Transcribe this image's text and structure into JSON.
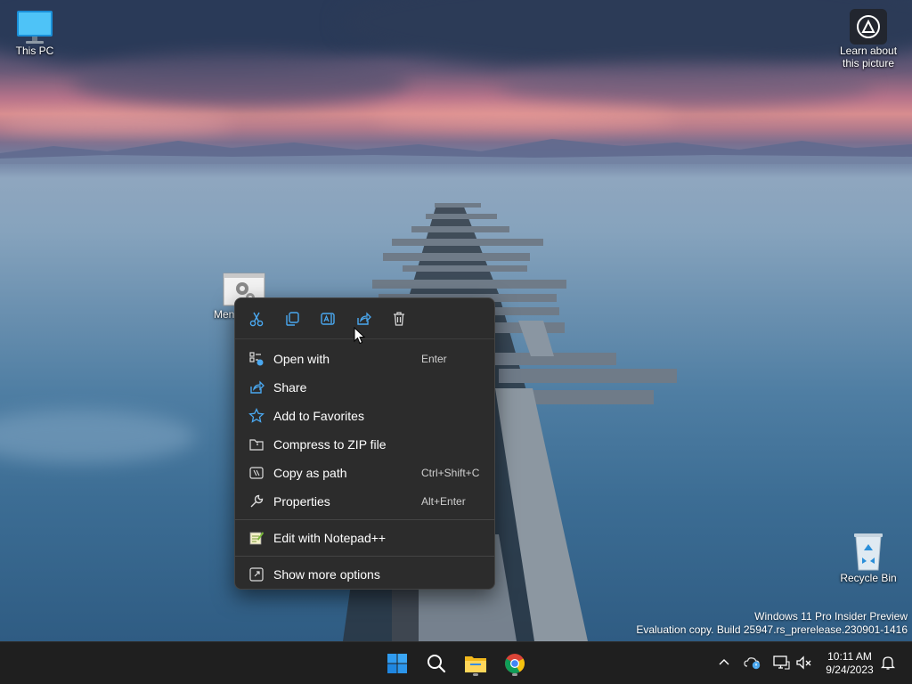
{
  "desktop": {
    "icons": [
      {
        "label": "This PC"
      },
      {
        "label": "Men"
      },
      {
        "label": "Recycle Bin"
      }
    ],
    "learn_about": {
      "line1": "Learn about",
      "line2": "this picture"
    },
    "watermark": {
      "line1": "Windows 11 Pro Insider Preview",
      "line2": "Evaluation copy. Build 25947.rs_prerelease.230901-1416"
    }
  },
  "context_menu": {
    "toolbar": [
      {
        "name": "cut-icon",
        "label": "Cut"
      },
      {
        "name": "copy-icon",
        "label": "Copy"
      },
      {
        "name": "rename-icon",
        "label": "Rename"
      },
      {
        "name": "share-icon",
        "label": "Share"
      },
      {
        "name": "delete-icon",
        "label": "Delete"
      }
    ],
    "items": [
      {
        "icon": "open-with-icon",
        "label": "Open with",
        "shortcut": "Enter"
      },
      {
        "icon": "share-icon",
        "label": "Share",
        "shortcut": ""
      },
      {
        "icon": "star-icon",
        "label": "Add to Favorites",
        "shortcut": ""
      },
      {
        "icon": "zip-folder-icon",
        "label": "Compress to ZIP file",
        "shortcut": ""
      },
      {
        "icon": "copy-path-icon",
        "label": "Copy as path",
        "shortcut": "Ctrl+Shift+C"
      },
      {
        "icon": "wrench-icon",
        "label": "Properties",
        "shortcut": "Alt+Enter"
      }
    ],
    "extra_items": [
      {
        "icon": "notepadpp-icon",
        "label": "Edit with Notepad++"
      },
      {
        "icon": "show-more-icon",
        "label": "Show more options"
      }
    ]
  },
  "taskbar": {
    "apps": [
      "start-icon",
      "search-icon",
      "file-explorer-icon",
      "chrome-icon"
    ],
    "tray": [
      "chevron-up-icon",
      "onedrive-icon",
      "display-icon",
      "volume-muted-icon"
    ],
    "clock": {
      "time": "10:11 AM",
      "date": "9/24/2023"
    }
  },
  "colors": {
    "menu_bg": "#2c2c2c",
    "taskbar_bg": "#1f1f1f",
    "accent": "#4aa8f0"
  }
}
